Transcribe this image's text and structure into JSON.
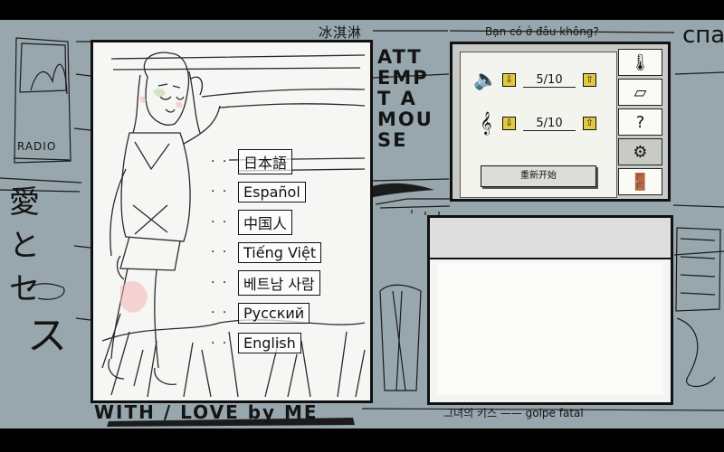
{
  "decor": {
    "top_caption": "冰淇淋",
    "viet_caption": "Bạn có ở đâu không?",
    "radio_label": "RADIO",
    "jp_text": "愛と",
    "jp_text2": "セ",
    "jp_s": "ス",
    "vertical_title": "ATT EMP T A MOU SE",
    "vertical_side": "спасибо",
    "footer_left": "WITH / LOVE by ME",
    "footer_right": "그녀의 키스 —— golpe fatal"
  },
  "languages": [
    {
      "label": "日本語"
    },
    {
      "label": "Español"
    },
    {
      "label": "中国人"
    },
    {
      "label": "Tiếng Việt"
    },
    {
      "label": "베트남 사람"
    },
    {
      "label": "Русский"
    },
    {
      "label": "English"
    }
  ],
  "settings": {
    "volume_value": "5/10",
    "music_value": "5/10",
    "restart_label": "重新开始",
    "volume_icon": "speaker-icon",
    "music_icon": "treble-clef-icon"
  },
  "tabs": [
    {
      "icon": "thermometer-icon",
      "glyph": "🌡"
    },
    {
      "icon": "paper-icon",
      "glyph": "▱"
    },
    {
      "icon": "question-icon",
      "glyph": "?"
    },
    {
      "icon": "gear-icon",
      "glyph": "⚙"
    },
    {
      "icon": "exit-door-icon",
      "glyph": "🚪"
    }
  ],
  "colors": {
    "background": "#97a7ad",
    "accent_button": "#e2c93f",
    "panel": "#f4f4ef"
  }
}
